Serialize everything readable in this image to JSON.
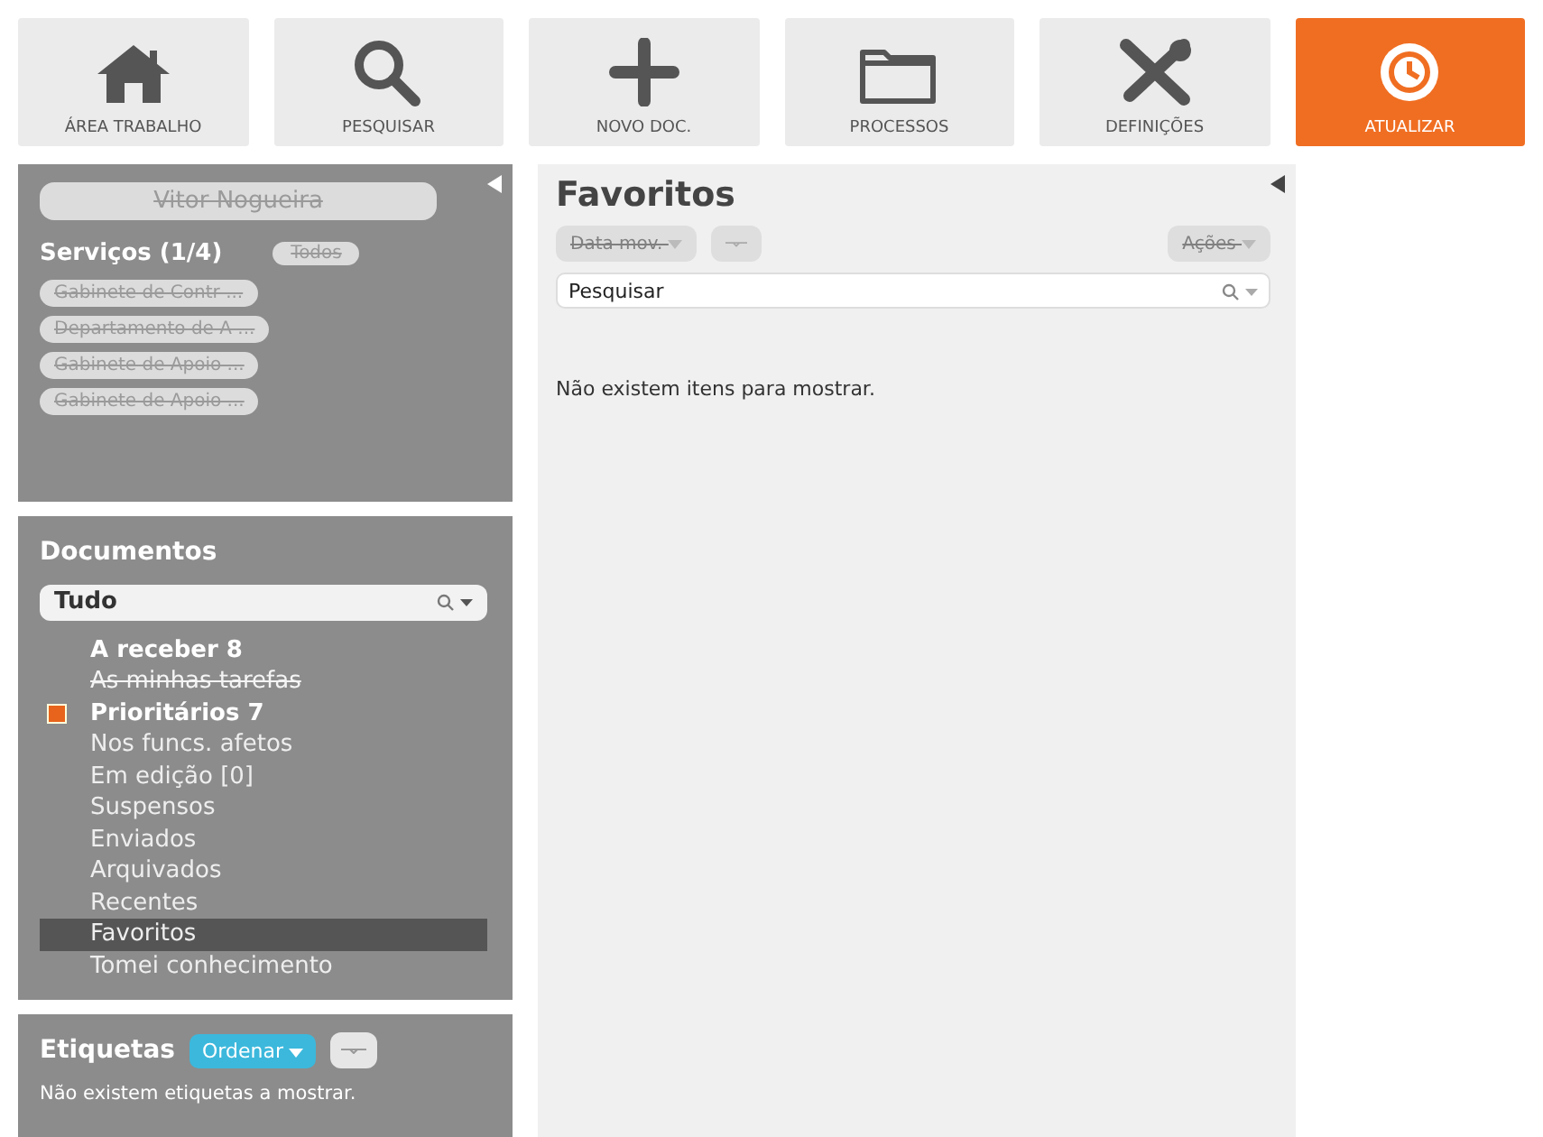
{
  "toolbar": [
    {
      "label": "ÁREA TRABALHO",
      "active": false
    },
    {
      "label": "PESQUISAR",
      "active": false
    },
    {
      "label": "NOVO DOC.",
      "active": false
    },
    {
      "label": "PROCESSOS",
      "active": false
    },
    {
      "label": "DEFINIÇÕES",
      "active": false
    },
    {
      "label": "ATUALIZAR",
      "active": true
    }
  ],
  "user": {
    "name": "Vitor Nogueira",
    "disabled": true
  },
  "services": {
    "title": "Serviços (1/4)",
    "all_button": {
      "label": "Todos",
      "disabled": true
    },
    "items": [
      {
        "label": "Gabinete de Contr ...",
        "disabled": true
      },
      {
        "label": "Departamento de A ...",
        "disabled": true
      },
      {
        "label": "Gabinete de Apoio ...",
        "disabled": true
      },
      {
        "label": "Gabinete de Apoio ...",
        "disabled": true
      }
    ]
  },
  "documents": {
    "title": "Documentos",
    "filter": {
      "value": "Tudo"
    },
    "items": [
      {
        "label": "A receber 8",
        "bold": true,
        "disabled": false,
        "selected": false
      },
      {
        "label": "As minhas tarefas",
        "bold": false,
        "disabled": true,
        "selected": false
      },
      {
        "label": "Prioritários 7",
        "bold": true,
        "disabled": false,
        "selected": false,
        "color": "#e8641c"
      },
      {
        "label": "Nos funcs. afetos",
        "bold": false,
        "disabled": false,
        "selected": false
      },
      {
        "label": "Em edição [0]",
        "bold": false,
        "disabled": false,
        "selected": false
      },
      {
        "label": "Suspensos",
        "bold": false,
        "disabled": false,
        "selected": false
      },
      {
        "label": "Enviados",
        "bold": false,
        "disabled": false,
        "selected": false
      },
      {
        "label": "Arquivados",
        "bold": false,
        "disabled": false,
        "selected": false
      },
      {
        "label": "Recentes",
        "bold": false,
        "disabled": false,
        "selected": false
      },
      {
        "label": "Favoritos",
        "bold": false,
        "disabled": false,
        "selected": true
      },
      {
        "label": "Tomei conhecimento",
        "bold": false,
        "disabled": false,
        "selected": false
      }
    ]
  },
  "tags": {
    "title": "Etiquetas",
    "sort_button": "Ordenar",
    "empty": "Não existem etiquetas a mostrar."
  },
  "main": {
    "title": "Favoritos",
    "sort_button": {
      "label": "Data mov.",
      "disabled": true
    },
    "actions_button": {
      "label": "Ações",
      "disabled": true
    },
    "search": {
      "placeholder": "Pesquisar"
    },
    "empty": "Não existem itens para mostrar."
  }
}
